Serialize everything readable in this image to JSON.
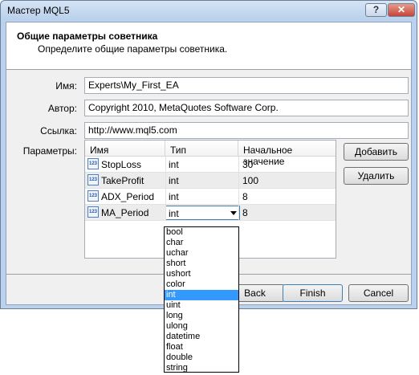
{
  "window": {
    "title": "Мастер MQL5",
    "help_glyph": "?",
    "close_glyph": "✕"
  },
  "header": {
    "title": "Общие параметры советника",
    "subtitle": "Определите общие параметры советника."
  },
  "form": {
    "name_label": "Имя:",
    "name_value": "Experts\\My_First_EA",
    "author_label": "Автор:",
    "author_value": "Copyright 2010, MetaQuotes Software Corp.",
    "link_label": "Ссылка:",
    "link_value": "http://www.mql5.com",
    "params_label": "Параметры:"
  },
  "params_table": {
    "columns": [
      "Имя",
      "Тип",
      "Начальное значение"
    ],
    "icon_text": "123",
    "rows": [
      {
        "name": "StopLoss",
        "type": "int",
        "value": "30"
      },
      {
        "name": "TakeProfit",
        "type": "int",
        "value": "100"
      },
      {
        "name": "ADX_Period",
        "type": "int",
        "value": "8"
      },
      {
        "name": "MA_Period",
        "type": "int",
        "value": "8"
      }
    ]
  },
  "side_buttons": {
    "add": "Добавить",
    "remove": "Удалить"
  },
  "footer_buttons": {
    "back": "Back",
    "finish": "Finish",
    "cancel": "Cancel"
  },
  "type_dropdown": {
    "selected": "int",
    "options": [
      "bool",
      "char",
      "uchar",
      "short",
      "ushort",
      "color",
      "int",
      "uint",
      "long",
      "ulong",
      "datetime",
      "float",
      "double",
      "string"
    ]
  }
}
